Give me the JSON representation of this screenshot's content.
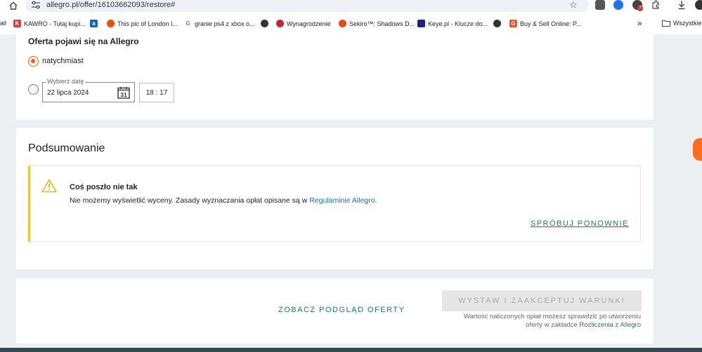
{
  "browser": {
    "url": "allegro.pl/offer/16103662093/restore#",
    "extension_badge": "7",
    "bookmarks": [
      {
        "label": "ail"
      },
      {
        "label": "KAWRO - Tutaj kupi..."
      },
      {
        "label": ""
      },
      {
        "label": "This pic of London I..."
      },
      {
        "label": "granie ps4 z xbox o..."
      },
      {
        "label": ""
      },
      {
        "label": "Wynagrodzenie"
      },
      {
        "label": "Sekiro™: Shadows D..."
      },
      {
        "label": "Keye.pl - Klucze do..."
      },
      {
        "label": ""
      },
      {
        "label": "Buy & Sell Online: P..."
      }
    ],
    "more_bookmarks": "»",
    "all_bookmarks": "Wszystkie"
  },
  "publish": {
    "title": "Oferta pojawi się na Allegro",
    "option_now": "natychmiast",
    "date_legend": "Wybierz datę",
    "date_value": "22 lipca 2024",
    "calendar_day": "31",
    "time_value": "18 : 17"
  },
  "summary": {
    "title": "Podsumowanie",
    "alert_title": "Coś poszło nie tak",
    "alert_message": "Nie możemy wyświetlić wyceny. Zasady wyznaczania opłat opisane są w",
    "alert_link": "Regulaminie Allegro",
    "alert_period": ".",
    "retry": "SPRÓBUJ PONOWNIE"
  },
  "actions": {
    "preview": "ZOBACZ PODGLĄD OFERTY",
    "submit": "WYSTAW I ZAAKCEPTUJ WARUNKI",
    "fee_note_1": "Wartość naliczonych opłat możesz sprawdzić po utworzeniu",
    "fee_note_2": "oferty w zakładce",
    "fee_link": "Rozliczenia z Allegro"
  },
  "colors": {
    "accent": "#ff5a00",
    "link": "#1a7a70",
    "warning": "#f2c12e"
  }
}
